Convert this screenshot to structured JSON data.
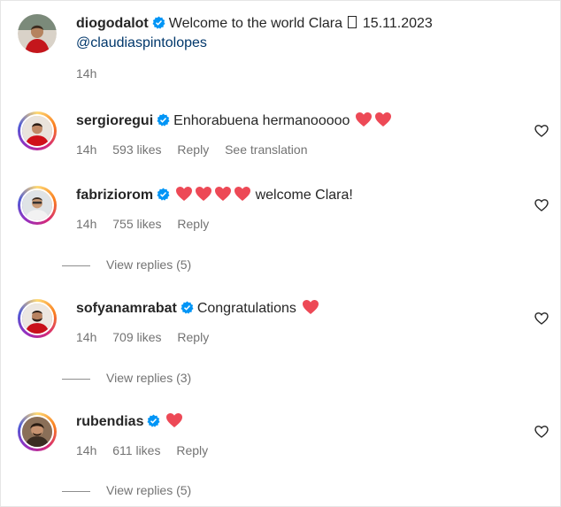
{
  "caption": {
    "username": "diogodalot",
    "text": "Welcome to the world Clara",
    "date": "15.11.2023",
    "mention": "@claudiaspintolopes",
    "time": "14h"
  },
  "comments": [
    {
      "username": "sergioregui",
      "text": "Enhorabuena hermanooooo",
      "hearts": 2,
      "time": "14h",
      "likes": "593 likes",
      "reply": "Reply",
      "extra": "See translation"
    },
    {
      "username": "fabriziorom",
      "text": "welcome Clara!",
      "hearts_before": 4,
      "time": "14h",
      "likes": "755 likes",
      "reply": "Reply",
      "view_replies": "View replies (5)"
    },
    {
      "username": "sofyanamrabat",
      "text": "Congratulations",
      "hearts": 1,
      "time": "14h",
      "likes": "709 likes",
      "reply": "Reply",
      "view_replies": "View replies (3)"
    },
    {
      "username": "rubendias",
      "text": "",
      "hearts": 1,
      "time": "14h",
      "likes": "611 likes",
      "reply": "Reply",
      "view_replies": "View replies (5)"
    }
  ],
  "colors": {
    "verified": "#0095f6",
    "heart": "#ed4956",
    "meta": "#737373",
    "mention": "#00376b"
  },
  "icons": {
    "verified": "verified-badge-icon",
    "like": "heart-outline-icon",
    "emoji_heart": "red-heart-emoji"
  }
}
